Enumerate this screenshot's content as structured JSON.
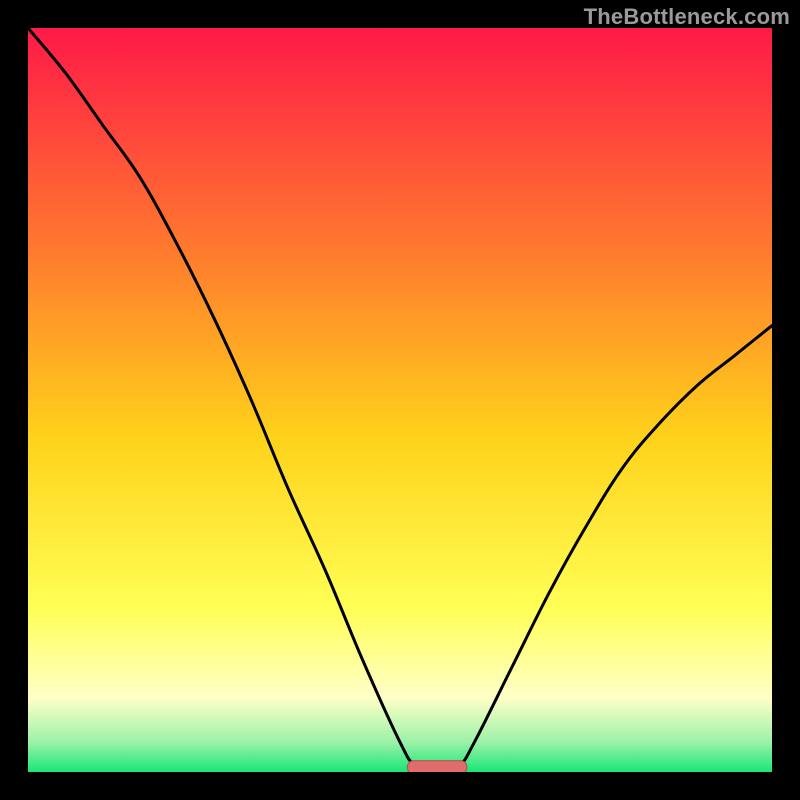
{
  "watermark": "TheBottleneck.com",
  "colors": {
    "frame_bg": "#000000",
    "gradient_top": "#ff1948",
    "gradient_upper_mid": "#ff7a2e",
    "gradient_mid": "#ffd21a",
    "gradient_lower_mid": "#ffff55",
    "gradient_pale": "#ffffc8",
    "gradient_green_light": "#9cf2a8",
    "gradient_green": "#19e676",
    "curve_stroke": "#000000",
    "marker_fill": "#e26c6c",
    "marker_stroke": "#b34a4a",
    "watermark": "#9a9a9a"
  },
  "chart_data": {
    "type": "line",
    "title": "",
    "xlabel": "",
    "ylabel": "",
    "xlim": [
      0,
      100
    ],
    "ylim": [
      0,
      100
    ],
    "marker": {
      "x_center": 55,
      "x_halfwidth": 4,
      "y": 0.7
    },
    "curve": [
      {
        "x": 0,
        "y": 100
      },
      {
        "x": 5,
        "y": 94
      },
      {
        "x": 10,
        "y": 87
      },
      {
        "x": 15,
        "y": 80
      },
      {
        "x": 20,
        "y": 71
      },
      {
        "x": 25,
        "y": 61
      },
      {
        "x": 30,
        "y": 50
      },
      {
        "x": 35,
        "y": 38
      },
      {
        "x": 40,
        "y": 27
      },
      {
        "x": 45,
        "y": 15
      },
      {
        "x": 50,
        "y": 4
      },
      {
        "x": 52,
        "y": 1
      },
      {
        "x": 55,
        "y": 0.5
      },
      {
        "x": 58,
        "y": 1
      },
      {
        "x": 60,
        "y": 4
      },
      {
        "x": 65,
        "y": 14
      },
      {
        "x": 70,
        "y": 24
      },
      {
        "x": 75,
        "y": 33
      },
      {
        "x": 80,
        "y": 41
      },
      {
        "x": 85,
        "y": 47
      },
      {
        "x": 90,
        "y": 52
      },
      {
        "x": 95,
        "y": 56
      },
      {
        "x": 100,
        "y": 60
      }
    ]
  }
}
